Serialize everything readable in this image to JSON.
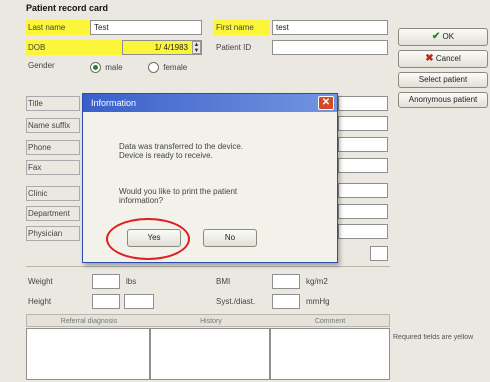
{
  "window": {
    "title": "Patient record card"
  },
  "fields": {
    "last_name": {
      "label": "Last name",
      "value": "Test"
    },
    "first_name": {
      "label": "First name",
      "value": "test"
    },
    "dob": {
      "label": "DOB",
      "value": "1/ 4/1983"
    },
    "patient_id": {
      "label": "Patient ID",
      "value": ""
    },
    "gender": {
      "label": "Gender",
      "male": "male",
      "female": "female",
      "selected": "male"
    },
    "title": {
      "label": "Title"
    },
    "name_suffix": {
      "label": "Name suffix"
    },
    "phone": {
      "label": "Phone"
    },
    "fax": {
      "label": "Fax"
    },
    "clinic": {
      "label": "Clinic"
    },
    "department": {
      "label": "Department"
    },
    "physician": {
      "label": "Physician"
    },
    "weight": {
      "label": "Weight",
      "unit": "lbs"
    },
    "height": {
      "label": "Height"
    },
    "bmi": {
      "label": "BMI",
      "unit": "kg/m2"
    },
    "syst_diast": {
      "label": "Syst./diast.",
      "unit": "mmHg"
    }
  },
  "table": {
    "columns": [
      "Referral diagnosis",
      "History",
      "Comment"
    ]
  },
  "buttons": {
    "ok": "OK",
    "cancel": "Cancel",
    "select_patient": "Select patient",
    "anonymous_patient": "Anonymous patient"
  },
  "status": "Required fields are yellow",
  "dialog": {
    "title": "Information",
    "message1": "Data was transferred to the device. Device is ready to receive.",
    "message2": "Would you like to print the patient information?",
    "yes": "Yes",
    "no": "No"
  },
  "colors": {
    "required": "#fbf63a",
    "titlebar": "#3a5fc9",
    "highlight_circle": "#e01f1f"
  }
}
